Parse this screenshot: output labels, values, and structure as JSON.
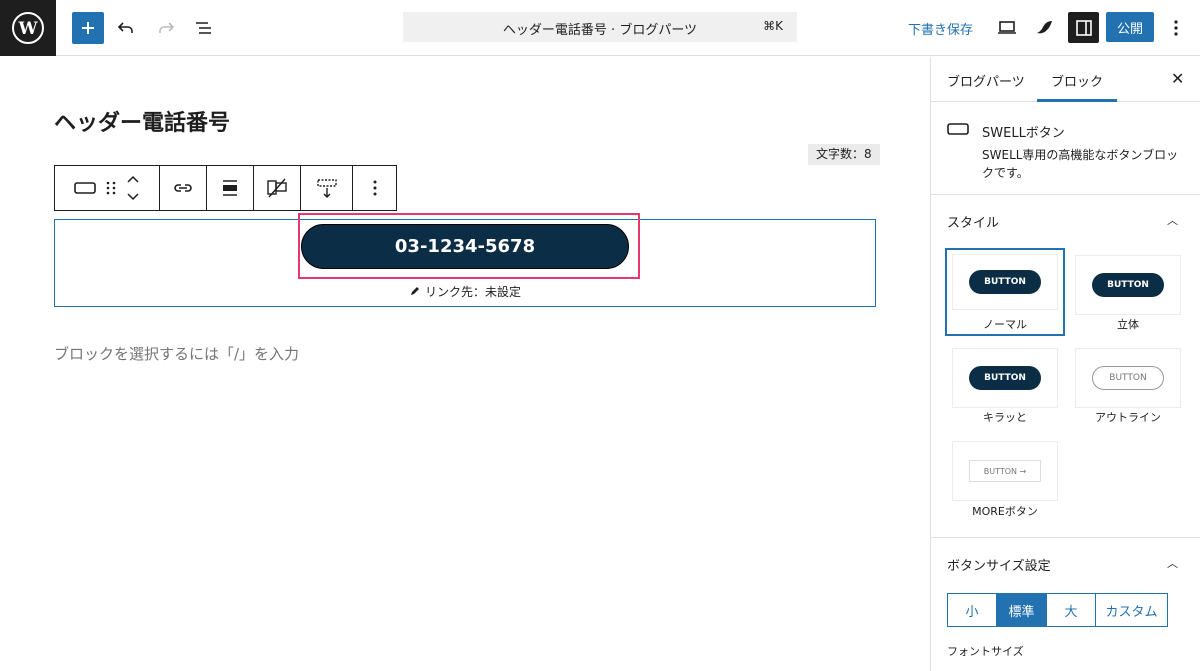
{
  "header": {
    "document_title": "ヘッダー電話番号 · ブログパーツ",
    "shortcut": "⌘K",
    "save_draft_label": "下書き保存",
    "publish_label": "公開"
  },
  "editor": {
    "page_title": "ヘッダー電話番号",
    "char_count": "文字数：8",
    "button_text": "03-1234-5678",
    "link_info": "リンク先：未設定",
    "placeholder": "ブロックを選択するには「/」を入力"
  },
  "sidebar": {
    "tabs": [
      "ブログパーツ",
      "ブロック"
    ],
    "active_tab": 1,
    "block_name": "SWELLボタン",
    "block_description": "SWELL専用の高機能なボタンブロックです。",
    "style_section_title": "スタイル",
    "styles": [
      {
        "label": "ノーマル",
        "preview": "BUTTON",
        "selected": true
      },
      {
        "label": "立体",
        "preview": "BUTTON",
        "selected": false
      },
      {
        "label": "キラッと",
        "preview": "BUTTON",
        "selected": false
      },
      {
        "label": "アウトライン",
        "preview": "BUTTON",
        "selected": false
      },
      {
        "label": "MOREボタン",
        "preview": "BUTTON →",
        "selected": false
      }
    ],
    "size_section_title": "ボタンサイズ設定",
    "sizes": [
      "小",
      "標準",
      "大",
      "カスタム"
    ],
    "active_size": 1,
    "font_size_label": "フォントサイズ"
  },
  "colors": {
    "accent": "#2271b1",
    "button_bg": "#0b2d46",
    "highlight": "#e6386f"
  }
}
